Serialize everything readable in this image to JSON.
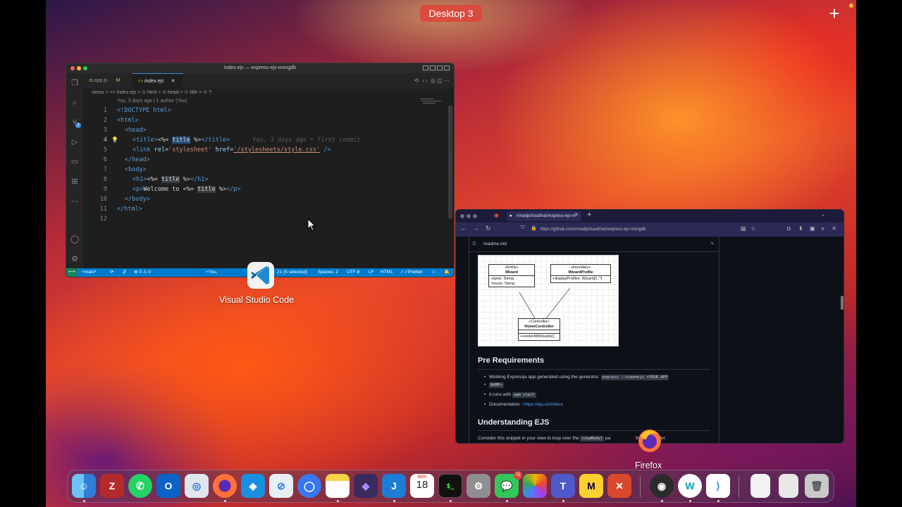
{
  "mission_control": {
    "desktop_label": "Desktop 3",
    "add_symbol": "+"
  },
  "vscode": {
    "window_title": "index.ejs — express-ejs-mongdb",
    "tabs": [
      {
        "label": "app.js",
        "status": "M",
        "lang_badge": "JS"
      },
      {
        "label": "index.ejs",
        "lang_badge": "<>"
      }
    ],
    "breadcrumb": "views > <> index.ejs > ⊙ html > ⊙ head > ⊙ title > ⊙ ?",
    "blame_header": "You, 3 days ago | 1 author (You)",
    "blame_inline": "You, 3 days ago • first commit",
    "lines": [
      {
        "n": "1"
      },
      {
        "n": "2"
      },
      {
        "n": "3"
      },
      {
        "n": "4"
      },
      {
        "n": "5"
      },
      {
        "n": "6"
      },
      {
        "n": "7"
      },
      {
        "n": "8"
      },
      {
        "n": "9"
      },
      {
        "n": "10"
      },
      {
        "n": "11"
      },
      {
        "n": "12"
      }
    ],
    "code": {
      "l1": "<!DOCTYPE html>",
      "l2_tag": "<html>",
      "l3_tag": "<head>",
      "l4_open": "<title>",
      "l4_ejs_open": "<%= ",
      "l4_var": "title",
      "l4_ejs_close": " %>",
      "l4_close": "</title>",
      "l5_open": "<link ",
      "l5_rel_attr": "rel=",
      "l5_rel_val": "'stylesheet'",
      "l5_href_attr": " href=",
      "l5_href_val": "'/stylesheets/style.css'",
      "l5_close": " />",
      "l6": "</head>",
      "l7": "<body>",
      "l8_open": "<h1>",
      "l8_ejs": "<%= ",
      "l8_var": "title",
      "l8_ejs_close": " %>",
      "l8_close": "</h1>",
      "l9_open": "<p>",
      "l9_text": "Welcome to ",
      "l9_ejs": "<%= ",
      "l9_var": "title",
      "l9_ejs_close": " %>",
      "l9_close": "</p>",
      "l10": "</body>",
      "l11": "</html>"
    },
    "status": {
      "branch": "main*",
      "problems": "⊗ 0 ⚠ 0",
      "blame": "You, 3 days ago",
      "selection": "21 (5 selected)",
      "spaces": "Spaces: 2",
      "encoding": "UTF-8",
      "eol": "LF",
      "language": "HTML",
      "formatter": "Prettier"
    },
    "scm_badge": "3",
    "app_label": "Visual Studio Code"
  },
  "firefox": {
    "tab_title": "ninadpchaudhari/express-ejs-m",
    "url": "https://github.com/ninadpchaudhari/express-ejs-mongdb",
    "readme_file": "readme.md",
    "uml": {
      "wizard_stereo": "«Entity»",
      "wizard_name": "Wizard",
      "wizard_attr1": "-name: String",
      "wizard_attr2": "-house: String",
      "profile_stereo": "«boundary»",
      "profile_name": "WizardProfile",
      "profile_attr": "+displayProfiles: Wizard[1..*]",
      "controller_stereo": "«Controller»",
      "controller_name": "HomeController",
      "controller_method": "+renderAllWizards()"
    },
    "prereq_heading": "Pre Requirements",
    "bullet1_text": "Working Expressjs app generated using the generator.",
    "bullet1_code_a": "express --view=ejs <YOUR_APP",
    "bullet1_code_b": "NAME>",
    "bullet2_text": "it runs with",
    "bullet2_code": "npm start",
    "bullet3_text": "Documentation :",
    "bullet3_link": "https://ejs.co/#docs",
    "ejs_heading": "Understanding EJS",
    "ejs_text_a": "Consider this snippet in your view to loop over the",
    "ejs_code": "viewModel",
    "ejs_text_b": "pa",
    "ejs_text_c": "from controller.",
    "app_label": "Firefox"
  },
  "dock": {
    "calendar_month": "NOV",
    "calendar_day": "18",
    "messages_badge": "75",
    "terminal_glyph": "$_",
    "items": [
      "finder",
      "zotero",
      "whatsapp",
      "outlook",
      "chrome",
      "firefox",
      "safari-alt",
      "safari",
      "signal",
      "notes",
      "obsidian",
      "jamf",
      "calendar",
      "terminal",
      "system-settings",
      "messages",
      "photos",
      "teams",
      "miro",
      "remote-desktop",
      "obs",
      "webex",
      "vscode",
      "document",
      "archive",
      "trash"
    ],
    "zotero_glyph": "Z",
    "jamf_glyph": "J",
    "webex_glyph": "W"
  }
}
